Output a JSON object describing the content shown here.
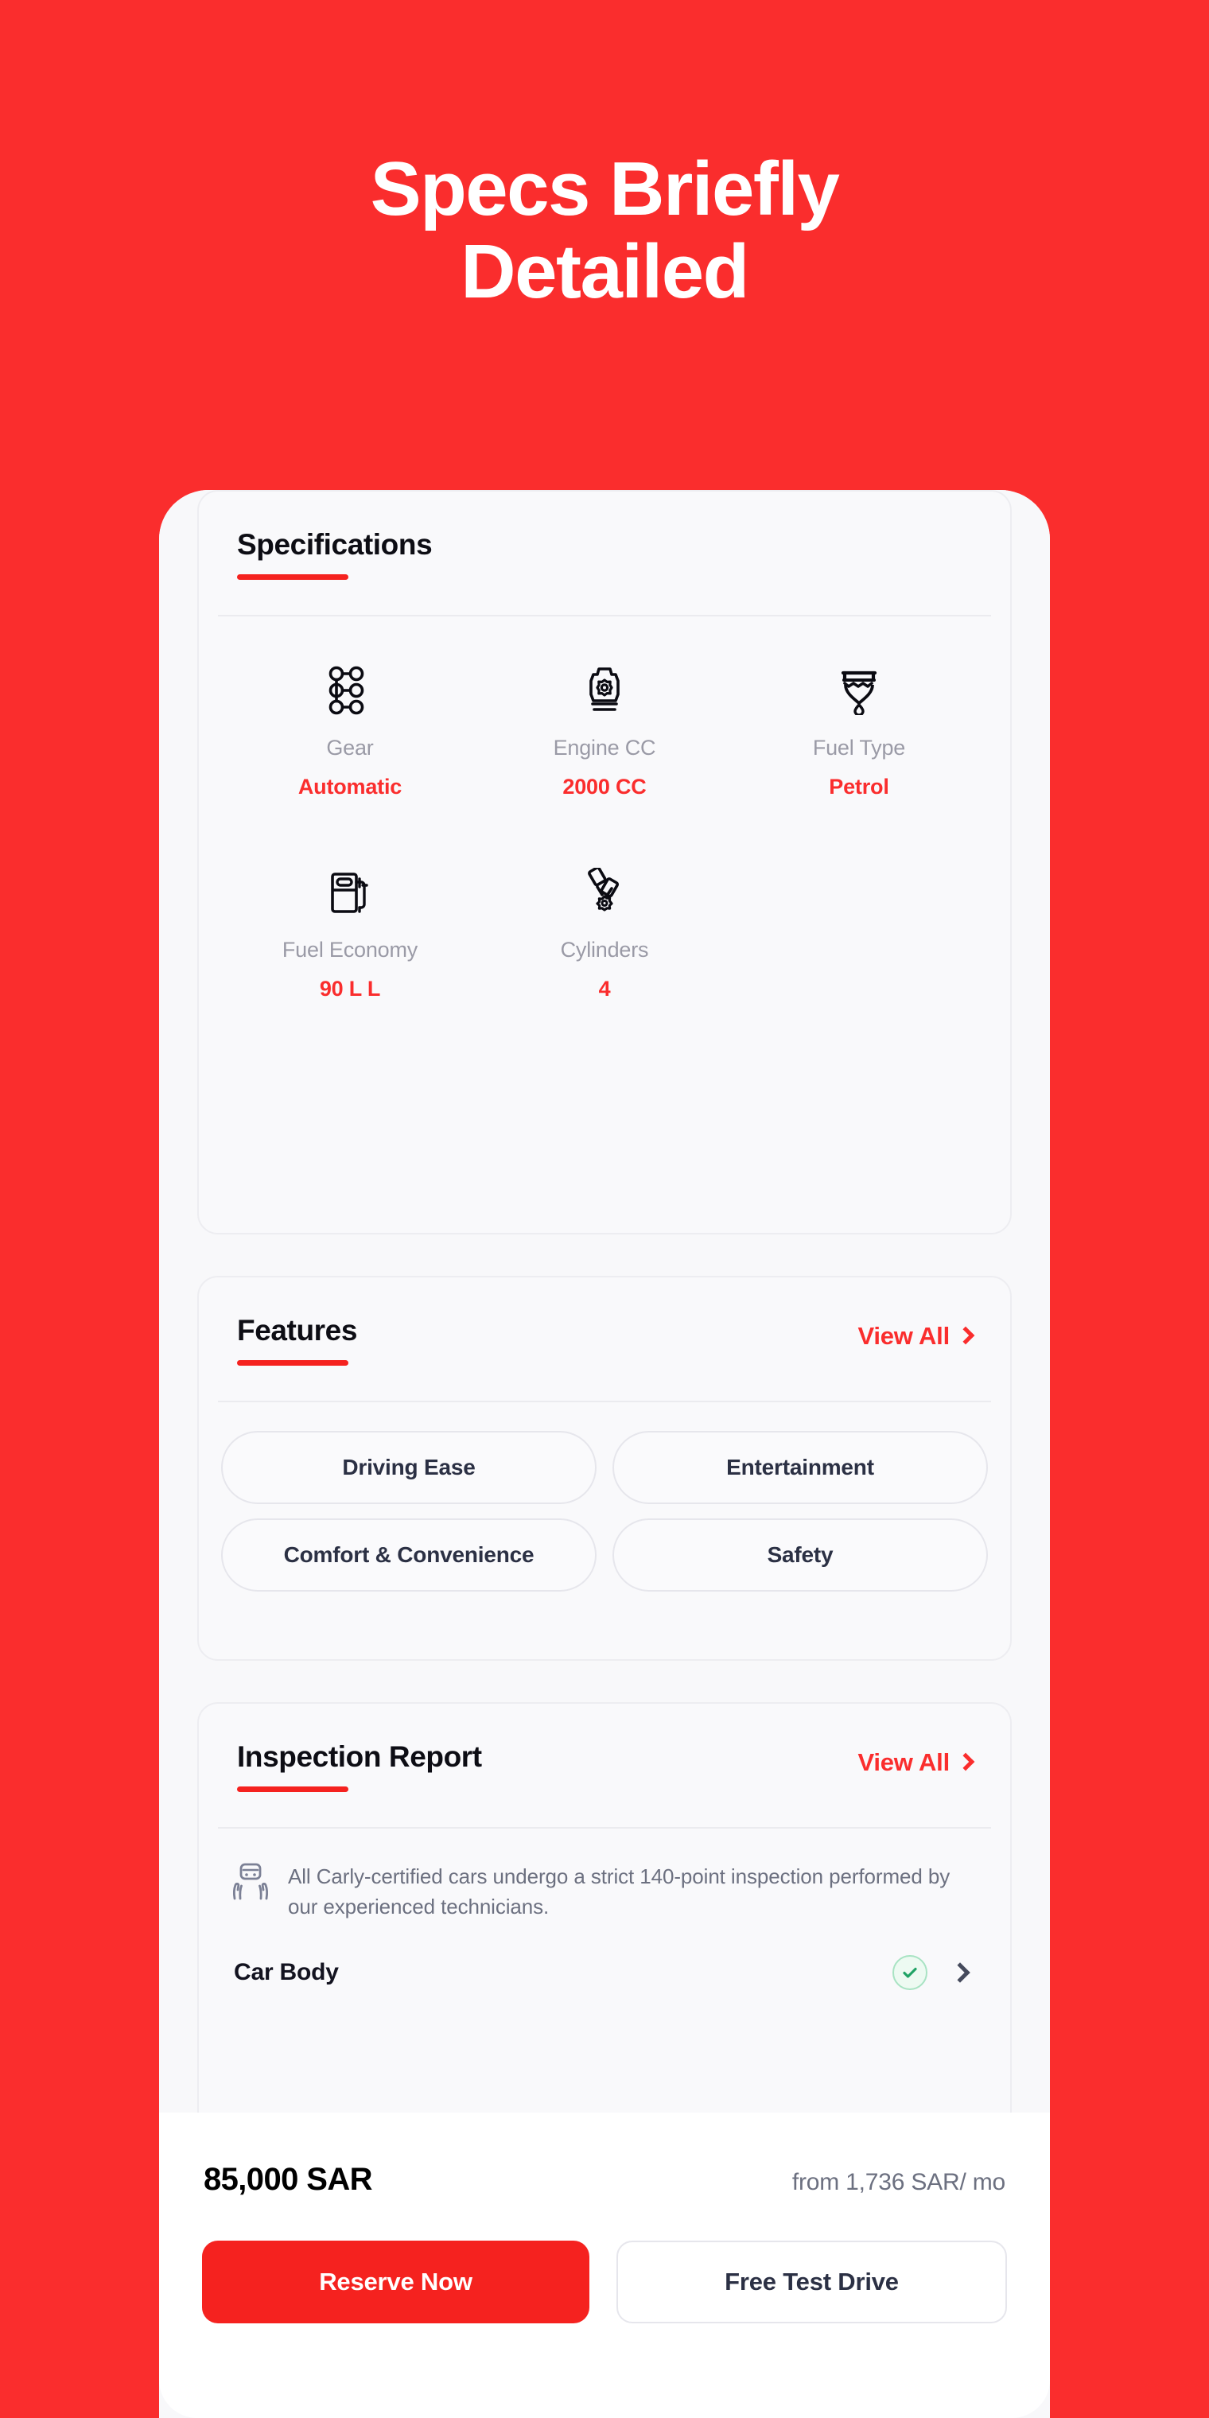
{
  "theme": {
    "background_red": "#FA2D2D",
    "accent_red": "#F5221F",
    "text_dark": "#0D0D14",
    "text_muted": "#9A9AA6",
    "check_green": "#21A366"
  },
  "headline": {
    "line1": "Specs Briefly",
    "line2": "Detailed"
  },
  "specifications": {
    "title": "Specifications",
    "items": [
      {
        "icon": "gearbox-icon",
        "label": "Gear",
        "value": "Automatic"
      },
      {
        "icon": "engine-icon",
        "label": "Engine CC",
        "value": "2000 CC"
      },
      {
        "icon": "fuel-drop-icon",
        "label": "Fuel Type",
        "value": "Petrol"
      },
      {
        "icon": "fuel-pump-icon",
        "label": "Fuel Economy",
        "value": "90 L L"
      },
      {
        "icon": "cylinders-icon",
        "label": "Cylinders",
        "value": "4"
      }
    ]
  },
  "features": {
    "title": "Features",
    "view_all_label": "View All",
    "chips": [
      {
        "label": "Driving Ease"
      },
      {
        "label": "Entertainment"
      },
      {
        "label": "Comfort & Convenience"
      },
      {
        "label": "Safety"
      }
    ]
  },
  "inspection": {
    "title": "Inspection Report",
    "view_all_label": "View All",
    "note": "All Carly-certified cars undergo a strict 140-point inspection performed by our experienced technicians.",
    "rows": [
      {
        "label": "Car Body",
        "status": "passed"
      }
    ]
  },
  "bottom_bar": {
    "price": "85,000 SAR",
    "financing": "from 1,736 SAR/ mo",
    "primary_button": "Reserve Now",
    "secondary_button": "Free Test Drive"
  }
}
